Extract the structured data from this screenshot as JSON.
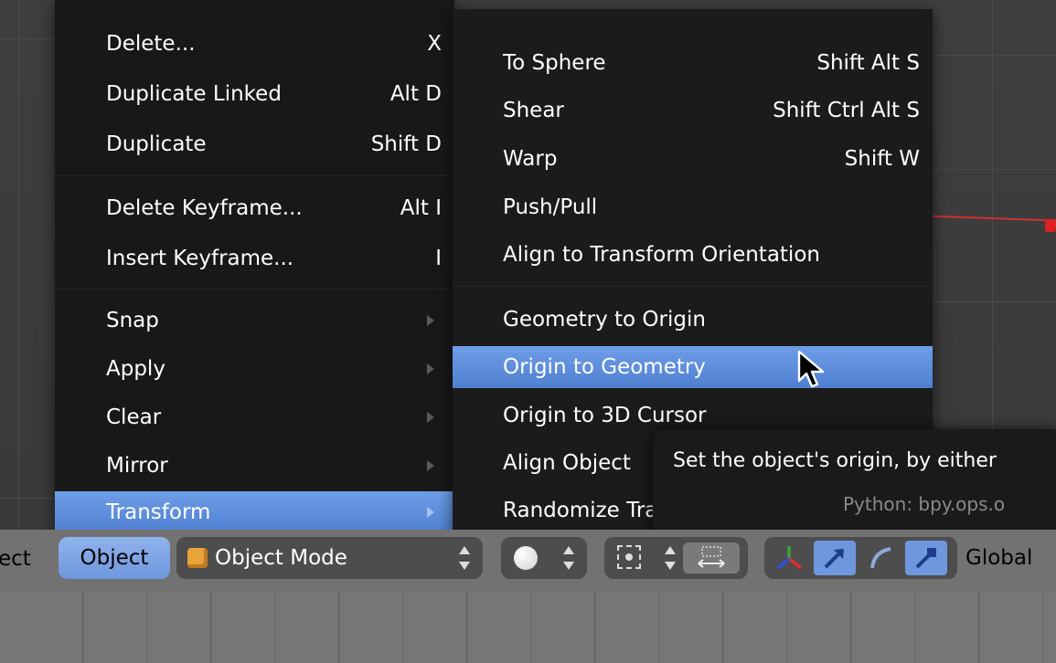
{
  "main_menu": {
    "items": [
      {
        "label": "Delete...",
        "shortcut": "X"
      },
      {
        "label": "Duplicate Linked",
        "shortcut": "Alt D"
      },
      {
        "label": "Duplicate",
        "shortcut": "Shift D"
      },
      {
        "label": "Delete Keyframe...",
        "shortcut": "Alt I"
      },
      {
        "label": "Insert Keyframe...",
        "shortcut": "I"
      },
      {
        "label": "Snap"
      },
      {
        "label": "Apply"
      },
      {
        "label": "Clear"
      },
      {
        "label": "Mirror"
      },
      {
        "label": "Transform"
      }
    ]
  },
  "sub_menu": {
    "items": [
      {
        "label": "To Sphere",
        "shortcut": "Shift Alt S"
      },
      {
        "label": "Shear",
        "shortcut": "Shift Ctrl Alt S"
      },
      {
        "label": "Warp",
        "shortcut": "Shift W"
      },
      {
        "label": "Push/Pull"
      },
      {
        "label": "Align to Transform Orientation"
      },
      {
        "label": "Geometry to Origin"
      },
      {
        "label": "Origin to Geometry"
      },
      {
        "label": "Origin to 3D Cursor"
      },
      {
        "label": "Align Object"
      },
      {
        "label": "Randomize Transform"
      }
    ]
  },
  "tooltip": {
    "description": "Set the object's origin, by either",
    "python": "Python: bpy.ops.o"
  },
  "header": {
    "partial_label": "ect",
    "object_menu": "Object",
    "mode": "Object Mode",
    "orientation": "Global"
  },
  "colors": {
    "highlight": "#5b8be0",
    "menu_bg": "#181818",
    "header_bg": "#727272"
  }
}
